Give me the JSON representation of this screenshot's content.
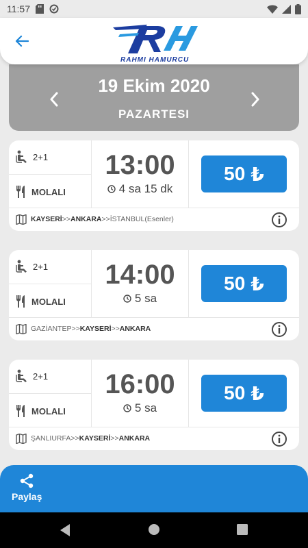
{
  "status_bar": {
    "time": "11:57"
  },
  "header": {
    "logo_text": "RAHMI HAMURCU"
  },
  "date": {
    "title": "19 Ekim 2020",
    "day": "PAZARTESI"
  },
  "colors": {
    "accent": "#1f86d8",
    "date_panel": "#9f9f9f",
    "logo": "#1c3da0"
  },
  "trips": [
    {
      "seat": "2+1",
      "service": "MOLALI",
      "time": "13:00",
      "duration": "4 sa 15 dk",
      "price": "50",
      "currency": "₺",
      "route": [
        {
          "text": "KAYSERİ",
          "bold": true
        },
        {
          "text": ">>",
          "bold": false
        },
        {
          "text": "ANKARA",
          "bold": true
        },
        {
          "text": ">>",
          "bold": false
        },
        {
          "text": "İSTANBUL(Esenler)",
          "bold": false
        }
      ]
    },
    {
      "seat": "2+1",
      "service": "MOLALI",
      "time": "14:00",
      "duration": "5 sa",
      "price": "50",
      "currency": "₺",
      "route": [
        {
          "text": "GAZİANTEP",
          "bold": false
        },
        {
          "text": ">>",
          "bold": false
        },
        {
          "text": "KAYSERİ",
          "bold": true
        },
        {
          "text": ">>",
          "bold": false
        },
        {
          "text": "ANKARA",
          "bold": true
        }
      ]
    },
    {
      "seat": "2+1",
      "service": "MOLALI",
      "time": "16:00",
      "duration": "5 sa",
      "price": "50",
      "currency": "₺",
      "route": [
        {
          "text": "ŞANLIURFA",
          "bold": false
        },
        {
          "text": ">>",
          "bold": false
        },
        {
          "text": "KAYSERİ",
          "bold": true
        },
        {
          "text": ">>",
          "bold": false
        },
        {
          "text": "ANKARA",
          "bold": true
        }
      ]
    }
  ],
  "share": {
    "label": "Paylaş"
  }
}
